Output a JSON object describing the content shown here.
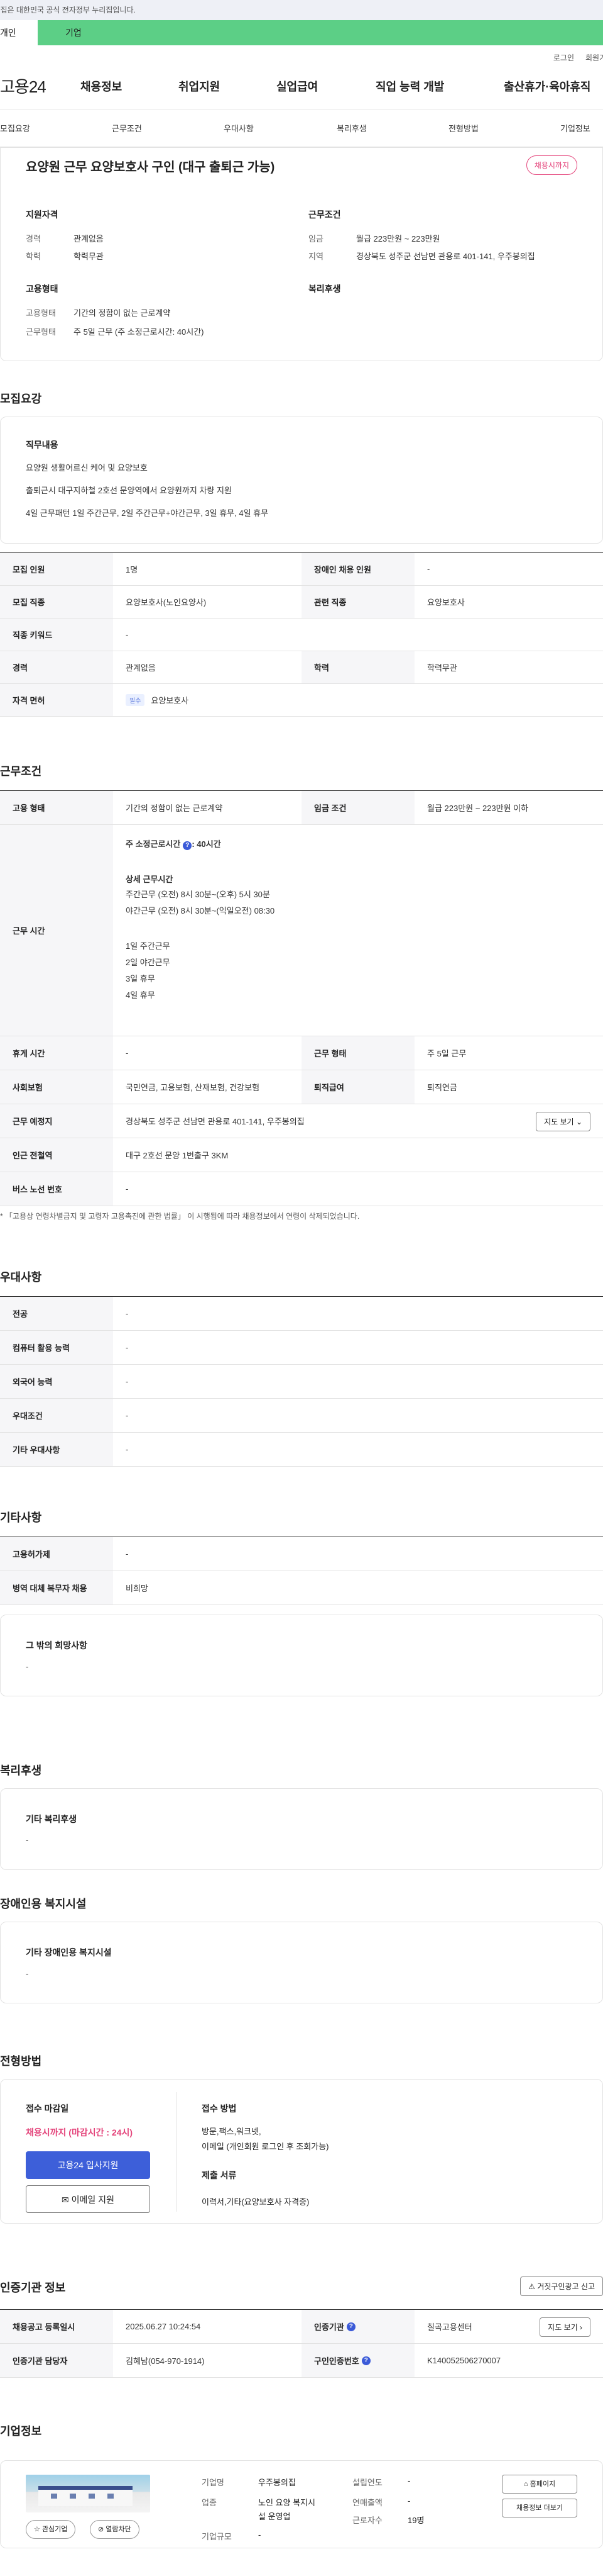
{
  "top_notice": "이 누리집은 대한민국 공식 전자정부 누리집입니다.",
  "user_tabs": [
    "개인",
    "기업"
  ],
  "util": [
    "로그인",
    "회원가입"
  ],
  "logo": "고용24",
  "gnb": [
    "채용정보",
    "취업지원",
    "실업급여",
    "직업 능력 개발",
    "출산휴가·육아휴직"
  ],
  "subnav": [
    "모집요강",
    "근무조건",
    "우대사항",
    "복리후생",
    "전형방법",
    "기업정보"
  ],
  "summary": {
    "title": "요양원 근무 요양보호사 구인 (대구 출퇴근 가능)",
    "badge": "채용시까지",
    "qual_h": "지원자격",
    "career_k": "경력",
    "career_v": "관계없음",
    "edu_k": "학력",
    "edu_v": "학력무관",
    "cond_h": "근무조건",
    "wage_k": "임금",
    "wage_v": "월급 223만원 ~ 223만원",
    "region_k": "지역",
    "region_v": "경상북도 성주군 선남면 관용로 401-141, 우주봉의집",
    "emp_h": "고용형태",
    "etype_k": "고용형태",
    "etype_v": "기간의 정함이 없는 근로계약",
    "wtype_k": "근무형태",
    "wtype_v": "주 5일 근무 (주 소정근로시간: 40시간)",
    "welfare_h": "복리후생"
  },
  "recruit": {
    "heading": "모집요강",
    "duty_h": "직무내용",
    "duty_lines": [
      "요양원 생활어르신 케어 및 요양보호",
      "출퇴근시 대구지하철 2호선 문양역에서 요양원까지 차량 지원",
      "4일 근무패턴 1일 주간근무, 2일 주간근무+야간근무, 3일 휴무, 4일 휴무"
    ],
    "rows": [
      {
        "k1": "모집 인원",
        "v1": "1명",
        "k2": "장애인 채용 인원",
        "v2": "-"
      },
      {
        "k1": "모집 직종",
        "v1": "요양보호사(노인요양사)",
        "k2": "관련 직종",
        "v2": "요양보호사"
      },
      {
        "k1": "직종 키워드",
        "v1": "-"
      },
      {
        "k1": "경력",
        "v1": "관계없음",
        "k2": "학력",
        "v2": "학력무관"
      },
      {
        "k1": "자격 면허",
        "chip": "필수",
        "v1": "요양보호사"
      }
    ]
  },
  "work": {
    "heading": "근무조건",
    "emp_k": "고용 형태",
    "emp_v": "기간의 정함이 없는 근로계약",
    "wage_k": "임금 조건",
    "wage_v": "월급 223만원 ~ 223만원 이하",
    "time_k": "근무 시간",
    "hours_label": "주 소정근로시간",
    "hours_value": ": 40시간",
    "detail_h": "상세 근무시간",
    "detail_lines": [
      "주간근무 (오전) 8시 30분~(오후) 5시 30분",
      "야간근무 (오전) 8시 30분~(익일오전) 08:30"
    ],
    "pattern": [
      "1일 주간근무",
      "2일 야간근무",
      "3일 휴무",
      "4일 휴무"
    ],
    "rest_k": "휴게 시간",
    "rest_v": "-",
    "form_k": "근무 형태",
    "form_v": "주 5일 근무",
    "ins_k": "사회보험",
    "ins_v": "국민연금, 고용보험, 산재보험, 건강보험",
    "ret_k": "퇴직급여",
    "ret_v": "퇴직연금",
    "place_k": "근무 예정지",
    "place_v": "경상북도 성주군 선남면 관용로 401-141, 우주봉의집",
    "map_btn": "지도 보기",
    "station_k": "인근 전철역",
    "station_v": "대구 2호선 문양 1번출구 3KM",
    "bus_k": "버스 노선 번호",
    "bus_v": "-",
    "note": "* 「고용상 연령차별금지 및 고령자 고용촉진에 관한 법률」 이 시행됨에 따라 채용정보에서 연령이 삭제되었습니다."
  },
  "pref": {
    "heading": "우대사항",
    "rows": [
      {
        "k": "전공",
        "v": "-"
      },
      {
        "k": "컴퓨터 활용 능력",
        "v": "-"
      },
      {
        "k": "외국어 능력",
        "v": "-"
      },
      {
        "k": "우대조건",
        "v": "-"
      },
      {
        "k": "기타 우대사항",
        "v": "-"
      }
    ]
  },
  "etc": {
    "heading": "기타사항",
    "rows": [
      {
        "k": "고용허가제",
        "v": "-"
      },
      {
        "k": "병역 대체 복무자 채용",
        "v": "비희망"
      }
    ],
    "other_h": "그 밖의 희망사항",
    "other_v": "-"
  },
  "welfare": {
    "heading": "복리후생",
    "h": "기타 복리후생",
    "v": "-"
  },
  "disabled": {
    "heading": "장애인용 복지시설",
    "h": "기타 장애인용 복지시설",
    "v": "-"
  },
  "apply": {
    "heading": "전형방법",
    "deadline_h": "접수 마감일",
    "deadline_v": "채용시까지 (마감시간 : 24시)",
    "btn_apply": "고용24 입사지원",
    "btn_email": "이메일 지원",
    "method_h": "접수 방법",
    "method_lines": [
      "방문,팩스,워크넷,",
      "이메일 (개인회원 로그인 후 조회가능)"
    ],
    "docs_h": "제출 서류",
    "docs_v": "이력서,기타(요양보호사 자격증)"
  },
  "cert": {
    "heading": "인증기관 정보",
    "report_btn": "거짓구인광고 신고",
    "reg_k": "채용공고 등록일시",
    "reg_v": "2025.06.27 10:24:54",
    "org_k": "인증기관",
    "org_v": "칠곡고용센터",
    "map_btn": "지도 보기",
    "mgr_k": "인증기관 담당자",
    "mgr_v": "김혜남(054-970-1914)",
    "num_k": "구인인증번호",
    "num_v": "K140052506270007"
  },
  "company": {
    "heading": "기업정보",
    "fav_btn": "관심기업",
    "block_btn": "열람차단",
    "name_k": "기업명",
    "name_v": "우주봉의집",
    "year_k": "설립연도",
    "year_v": "-",
    "ind_k": "업종",
    "ind_v": [
      "노인 요양 복지시",
      "설 운영업"
    ],
    "sales_k": "연매출액",
    "sales_v": "-",
    "staff_k": "근로자수",
    "staff_v": "19명",
    "scale_k": "기업규모",
    "scale_v": "-",
    "home_btn": "홈페이지",
    "info_btn": "채용정보 더보기"
  }
}
